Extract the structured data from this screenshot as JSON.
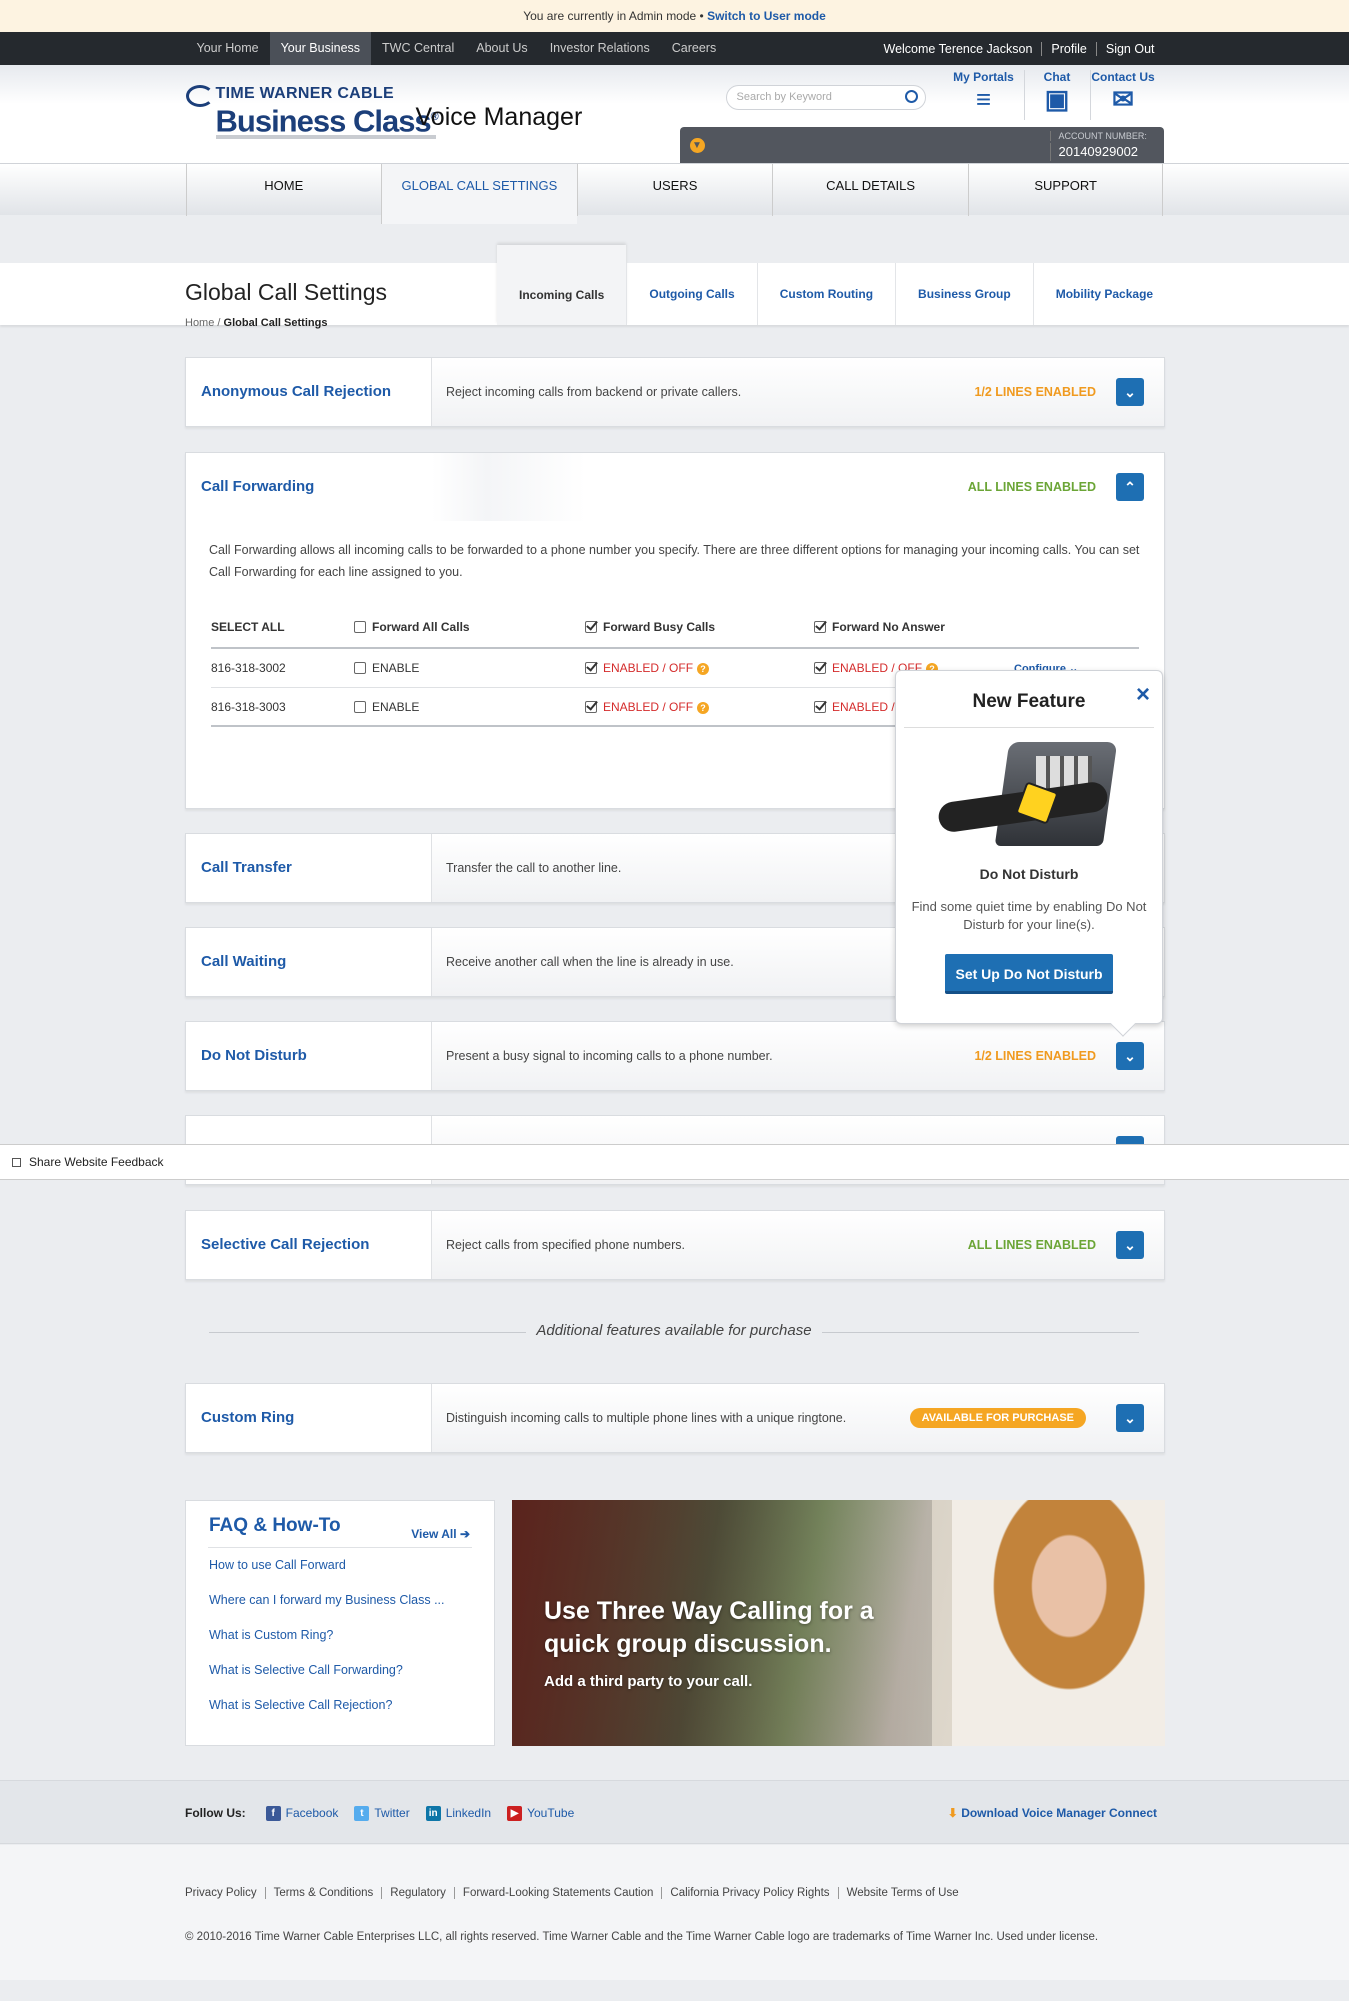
{
  "admin_bar": {
    "text": "You are currently in Admin mode •",
    "link": "Switch to User mode"
  },
  "topnav": {
    "items": [
      "Your Home",
      "Your Business",
      "TWC Central",
      "About Us",
      "Investor Relations",
      "Careers"
    ],
    "active": "Your Business",
    "welcome": "Welcome Terence Jackson",
    "profile": "Profile",
    "signout": "Sign Out"
  },
  "header": {
    "logo_top": "TIME WARNER CABLE",
    "logo_main": "Business Class",
    "logo_reg": "®",
    "app_name": "Voice Manager",
    "search_placeholder": "Search by Keyword",
    "links": [
      {
        "label": "My Portals",
        "icon": "menu-icon"
      },
      {
        "label": "Chat",
        "icon": "chat-icon"
      },
      {
        "label": "Contact Us",
        "icon": "envelope-icon"
      }
    ],
    "account_label": "ACCOUNT NUMBER:",
    "account_number": "20140929002"
  },
  "mainnav": {
    "items": [
      "HOME",
      "GLOBAL CALL SETTINGS",
      "USERS",
      "CALL DETAILS",
      "SUPPORT"
    ],
    "active": "GLOBAL CALL SETTINGS"
  },
  "page": {
    "title": "Global Call Settings",
    "tabs": [
      "Incoming Calls",
      "Outgoing Calls",
      "Custom Routing",
      "Business Group",
      "Mobility Package"
    ],
    "active_tab": "Incoming Calls",
    "breadcrumb_home": "Home /",
    "breadcrumb_current": "Global Call Settings"
  },
  "features": {
    "anon": {
      "name": "Anonymous Call Rejection",
      "desc": "Reject incoming calls from backend or private callers.",
      "status": "1/2 LINES ENABLED"
    },
    "forwarding": {
      "name": "Call Forwarding",
      "status": "ALL LINES ENABLED",
      "desc": "Call Forwarding allows all incoming calls to be forwarded to a phone number you specify. There are three different options for managing your incoming calls. You can set Call Forwarding for each line assigned to you.",
      "headers": [
        "SELECT ALL",
        "Forward All Calls",
        "Forward Busy Calls",
        "Forward No Answer"
      ],
      "rows": [
        {
          "line": "816-318-3002",
          "all": "ENABLE",
          "busy": "ENABLED / OFF",
          "noans": "ENABLED / OFF",
          "action": "Configure"
        },
        {
          "line": "816-318-3003",
          "all": "ENABLE",
          "busy": "ENABLED / OFF",
          "noans": "ENABLED / OFF",
          "action": ""
        }
      ]
    },
    "transfer": {
      "name": "Call Transfer",
      "desc": "Transfer the call to another line."
    },
    "waiting": {
      "name": "Call Waiting",
      "desc": "Receive another call when the line is already in use."
    },
    "dnd": {
      "name": "Do Not Disturb",
      "desc": "Present a busy signal to incoming calls to a phone number.",
      "status": "1/2 LINES ENABLED"
    },
    "selective": {
      "name": "Selective Call Rejection",
      "desc": "Reject calls from specified phone numbers.",
      "status": "ALL LINES ENABLED"
    },
    "additional_heading": "Additional features available for purchase",
    "custom_ring": {
      "name": "Custom Ring",
      "desc": "Distinguish incoming calls to multiple phone lines with a unique ringtone.",
      "badge": "AVAILABLE FOR PURCHASE"
    }
  },
  "popup": {
    "title": "New Feature",
    "close": "×",
    "feature_name": "Do Not Disturb",
    "desc": "Find some quiet time by enabling Do Not Disturb for your line(s).",
    "button": "Set Up Do Not Disturb"
  },
  "feedback": {
    "label": "Share Website Feedback"
  },
  "faq": {
    "title": "FAQ & How-To",
    "view_all": "View All",
    "items": [
      "How to use Call Forward",
      "Where can I forward my Business Class ...",
      "What is Custom Ring?",
      "What is Selective Call Forwarding?",
      "What is Selective Call Rejection?"
    ]
  },
  "promo": {
    "headline_1": "Use Three Way Calling for a",
    "headline_2": "quick group discussion.",
    "sub": "Add a third party to your call."
  },
  "follow": {
    "label": "Follow Us:",
    "networks": [
      "Facebook",
      "Twitter",
      "LinkedIn",
      "YouTube"
    ],
    "download": "Download Voice Manager Connect"
  },
  "footer": {
    "links": [
      "Privacy Policy",
      "Terms & Conditions",
      "Regulatory",
      "Forward-Looking Statements Caution",
      "California Privacy Policy Rights",
      "Website Terms of Use"
    ],
    "copyright": "© 2010-2016 Time Warner Cable Enterprises LLC, all rights reserved. Time Warner Cable and the Time Warner Cable logo are trademarks of Time Warner Inc. Used under license."
  },
  "colors": {
    "brand_blue": "#1e5aa8",
    "button_blue": "#1e6fb3",
    "orange": "#f09a1f",
    "green": "#6ba536",
    "dark_bar": "#25292e"
  }
}
